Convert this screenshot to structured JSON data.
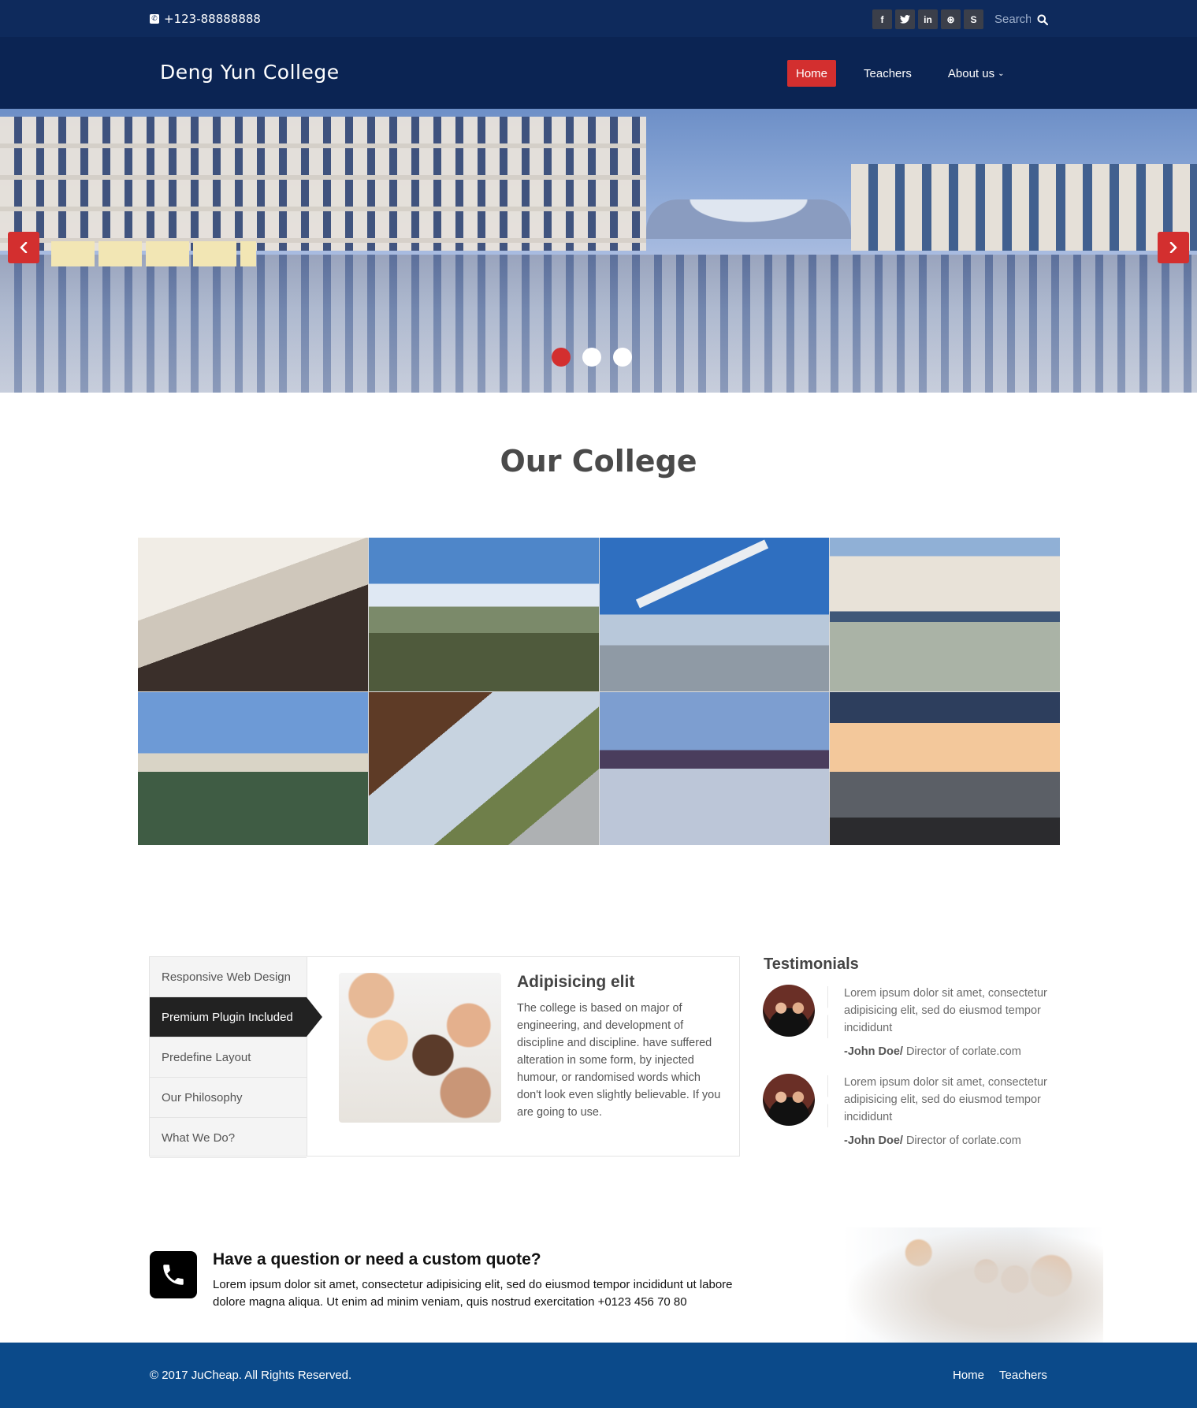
{
  "topbar": {
    "phone": "+123-88888888",
    "social": [
      {
        "icon": "facebook-icon",
        "glyph": "f"
      },
      {
        "icon": "twitter-icon",
        "glyph": "t"
      },
      {
        "icon": "linkedin-icon",
        "glyph": "in"
      },
      {
        "icon": "dribbble-icon",
        "glyph": "⊛"
      },
      {
        "icon": "skype-icon",
        "glyph": "S"
      }
    ],
    "search_placeholder": "Search"
  },
  "nav": {
    "brand": "Deng Yun College",
    "items": [
      {
        "label": "Home",
        "active": true
      },
      {
        "label": "Teachers",
        "active": false
      },
      {
        "label": "About us",
        "active": false,
        "dropdown": true
      }
    ]
  },
  "hero": {
    "slide_count": 3,
    "active_slide": 1
  },
  "college": {
    "title": "Our College"
  },
  "tabs": {
    "items": [
      {
        "label": "Responsive Web Design",
        "active": false
      },
      {
        "label": "Premium Plugin Included",
        "active": true
      },
      {
        "label": "Predefine Layout",
        "active": false
      },
      {
        "label": "Our Philosophy",
        "active": false
      },
      {
        "label": "What We Do?",
        "active": false
      }
    ],
    "content": {
      "title": "Adipisicing elit",
      "text": "The college is based on major of engineering, and development of discipline and discipline. have suffered alteration in some form, by injected humour, or randomised words which don't look even slightly believable. If you are going to use."
    }
  },
  "testimonials": {
    "title": "Testimonials",
    "items": [
      {
        "quote": "Lorem ipsum dolor sit amet, consectetur adipisicing elit, sed do eiusmod tempor incididunt",
        "name": "-John Doe/",
        "role": " Director of corlate.com"
      },
      {
        "quote": "Lorem ipsum dolor sit amet, consectetur adipisicing elit, sed do eiusmod tempor incididunt",
        "name": "-John Doe/",
        "role": " Director of corlate.com"
      }
    ]
  },
  "cta": {
    "title": "Have a question or need a custom quote?",
    "text": "Lorem ipsum dolor sit amet, consectetur adipisicing elit, sed do eiusmod tempor incididunt ut labore dolore magna aliqua. Ut enim ad minim veniam, quis nostrud exercitation +0123 456 70 80"
  },
  "footer": {
    "copyright": "© 2017 JuCheap. All Rights Reserved.",
    "links": [
      "Home",
      "Teachers"
    ]
  },
  "colors": {
    "topbar": "#0e2a5c",
    "navbar": "#0b2453",
    "accent": "#d32f2f",
    "footer": "#0b4a8a"
  }
}
